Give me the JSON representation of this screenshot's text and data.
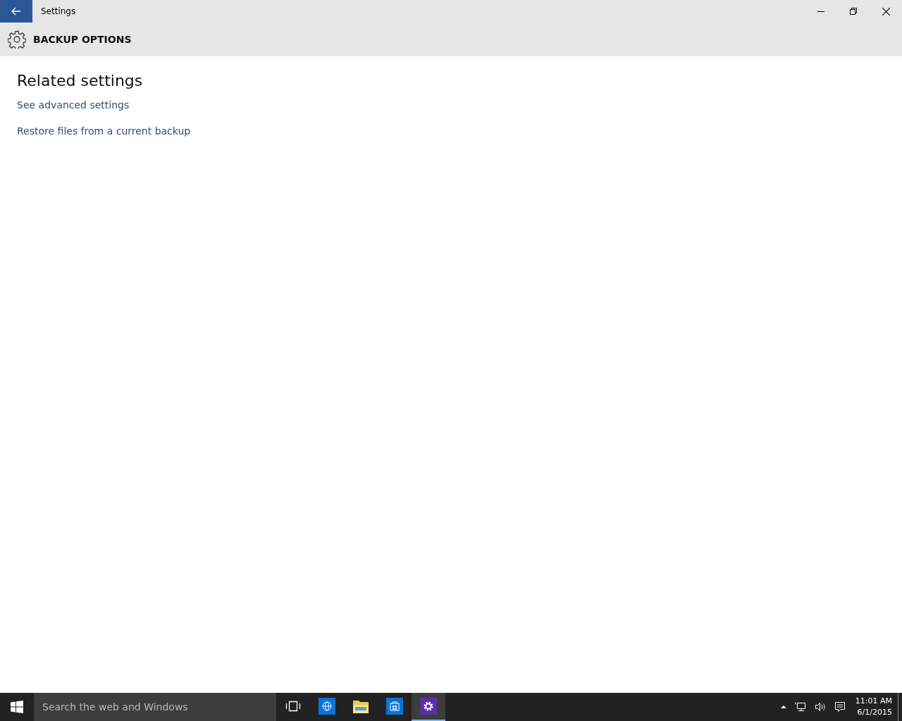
{
  "window": {
    "title": "Settings"
  },
  "header": {
    "title": "BACKUP OPTIONS"
  },
  "section": {
    "heading": "Related settings",
    "links": [
      "See advanced settings",
      "Restore files from a current backup"
    ]
  },
  "taskbar": {
    "search": {
      "placeholder": "Search the web and Windows"
    },
    "apps": [
      {
        "kind": "taskview",
        "selected": false
      },
      {
        "kind": "browser",
        "selected": false
      },
      {
        "kind": "explorer",
        "selected": false
      },
      {
        "kind": "store",
        "selected": false
      },
      {
        "kind": "settings",
        "selected": true
      }
    ],
    "time": "11:01 AM",
    "date": "6/1/2015"
  }
}
